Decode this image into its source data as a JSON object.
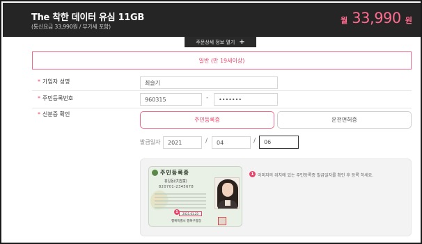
{
  "header": {
    "title": "The 착한 데이터 유심 11GB",
    "subtitle": "(통신요금 33,990원 / 부가세 포함)",
    "price_prefix": "월",
    "price_value": "33,990",
    "price_suffix": "원"
  },
  "detail_toggle": {
    "label": "주문상세 정보 열기",
    "icon": "plus-icon"
  },
  "category": {
    "label": "일반 (만 19세이상)"
  },
  "form": {
    "name": {
      "label": "가입자 성명",
      "value": "최슬기"
    },
    "resident_number": {
      "label": "주민등록번호",
      "front": "960315",
      "back": "•••••••",
      "separator": "-"
    },
    "id_verification": {
      "label": "신분증 확인",
      "options": [
        "주민등록증",
        "운전면허증"
      ],
      "selected": "주민등록증",
      "issue_date_label": "발급일자",
      "year": "2021",
      "month": "04",
      "day": "06",
      "date_separator": "/"
    }
  },
  "guide": {
    "card_title": "주민등록증",
    "card_name": "홍길동(洪吉童)",
    "card_number": "820701-2345678",
    "card_issue_date": "2021.01.25",
    "card_issuer": "행복특별시 행복구청장",
    "marker": "1",
    "text": "이미지의 위치에 있는 주민등록증 발급일자를 확인 후 등록 하세요."
  },
  "colors": {
    "accent": "#e8456c",
    "header_bg": "#252525",
    "price": "#ff6b8e"
  }
}
